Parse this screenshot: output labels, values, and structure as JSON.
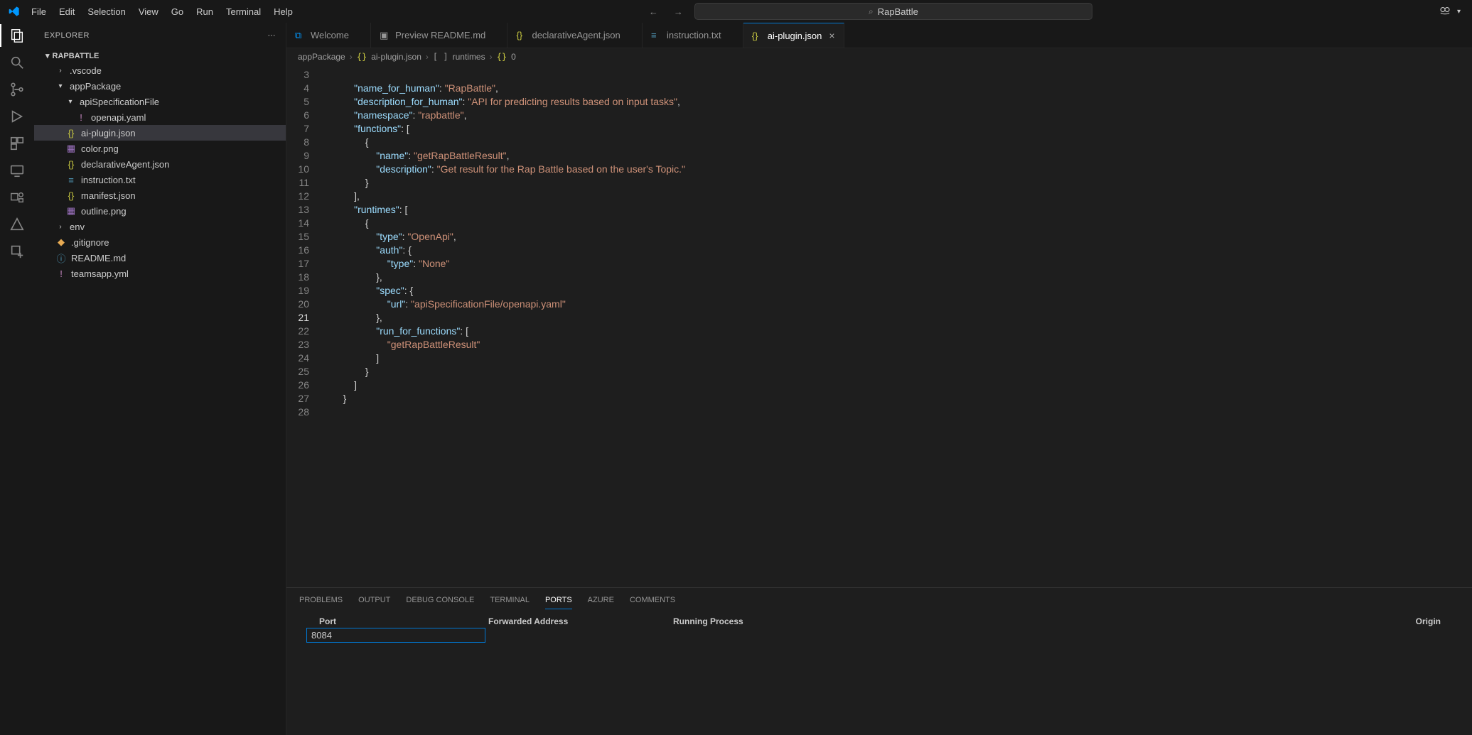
{
  "menu": {
    "file": "File",
    "edit": "Edit",
    "selection": "Selection",
    "view": "View",
    "go": "Go",
    "run": "Run",
    "terminal": "Terminal",
    "help": "Help"
  },
  "search_text": "RapBattle",
  "sidebar": {
    "title": "EXPLORER",
    "root": "RAPBATTLE",
    "files": {
      "vscode": ".vscode",
      "appPackage": "appPackage",
      "apiSpec": "apiSpecificationFile",
      "openapi": "openapi.yaml",
      "aiplugin": "ai-plugin.json",
      "colorpng": "color.png",
      "declAgent": "declarativeAgent.json",
      "instruction": "instruction.txt",
      "manifest": "manifest.json",
      "outline": "outline.png",
      "env": "env",
      "gitignore": ".gitignore",
      "readme": "README.md",
      "teamsapp": "teamsapp.yml"
    }
  },
  "tabs": {
    "welcome": "Welcome",
    "preview": "Preview README.md",
    "decl": "declarativeAgent.json",
    "instr": "instruction.txt",
    "aip": "ai-plugin.json"
  },
  "breadcrumb": {
    "p1": "appPackage",
    "p2": "ai-plugin.json",
    "p3": "runtimes",
    "p4": "0"
  },
  "code": {
    "l3": {
      "in": 2,
      "k": "\"name_for_human\"",
      "p": ": ",
      "v": "\"RapBattle\"",
      "t": ","
    },
    "l5": {
      "in": 2,
      "k": "\"description_for_human\"",
      "p": ": ",
      "v": "\"API for predicting results based on input tasks\"",
      "t": ","
    },
    "l6": {
      "in": 2,
      "k": "\"namespace\"",
      "p": ": ",
      "v": "\"rapbattle\"",
      "t": ","
    },
    "l7": {
      "in": 2,
      "k": "\"functions\"",
      "p": ": ",
      "b": "["
    },
    "l8": {
      "in": 3,
      "b": "{"
    },
    "l9": {
      "in": 4,
      "k": "\"name\"",
      "p": ": ",
      "v": "\"getRapBattleResult\"",
      "t": ","
    },
    "l10": {
      "in": 4,
      "k": "\"description\"",
      "p": ": ",
      "v": "\"Get result for the Rap Battle based on the user's Topic.\""
    },
    "l11": {
      "in": 3,
      "b": "}"
    },
    "l12": {
      "in": 2,
      "b": "],"
    },
    "l13": {
      "in": 2,
      "k": "\"runtimes\"",
      "p": ": ",
      "b": "["
    },
    "l14": {
      "in": 3,
      "b": "{"
    },
    "l15": {
      "in": 4,
      "k": "\"type\"",
      "p": ": ",
      "v": "\"OpenApi\"",
      "t": ","
    },
    "l16": {
      "in": 4,
      "k": "\"auth\"",
      "p": ": ",
      "b": "{"
    },
    "l17": {
      "in": 5,
      "k": "\"type\"",
      "p": ": ",
      "v": "\"None\""
    },
    "l18": {
      "in": 4,
      "b": "},"
    },
    "l19": {
      "in": 4,
      "k": "\"spec\"",
      "p": ": ",
      "b": "{"
    },
    "l20": {
      "in": 5,
      "k": "\"url\"",
      "p": ": ",
      "v": "\"apiSpecificationFile/openapi.yaml\""
    },
    "l21": {
      "in": 4,
      "b": "},"
    },
    "l22": {
      "in": 4,
      "k": "\"run_for_functions\"",
      "p": ": ",
      "b": "["
    },
    "l23": {
      "in": 5,
      "v": "\"getRapBattleResult\""
    },
    "l24": {
      "in": 4,
      "b": "]"
    },
    "l25": {
      "in": 3,
      "b": "}"
    },
    "l26": {
      "in": 2,
      "b": "]"
    },
    "l27": {
      "in": 1,
      "b": "}"
    }
  },
  "lineNumbers": [
    "3",
    "4",
    "5",
    "6",
    "7",
    "8",
    "9",
    "10",
    "11",
    "12",
    "13",
    "14",
    "15",
    "16",
    "17",
    "18",
    "19",
    "20",
    "21",
    "22",
    "23",
    "24",
    "25",
    "26",
    "27",
    "28"
  ],
  "panel": {
    "tabs": {
      "problems": "PROBLEMS",
      "output": "OUTPUT",
      "debug": "DEBUG CONSOLE",
      "terminal": "TERMINAL",
      "ports": "PORTS",
      "azure": "AZURE",
      "comments": "COMMENTS"
    },
    "cols": {
      "port": "Port",
      "fwd": "Forwarded Address",
      "proc": "Running Process",
      "origin": "Origin"
    },
    "port_value": "8084"
  }
}
